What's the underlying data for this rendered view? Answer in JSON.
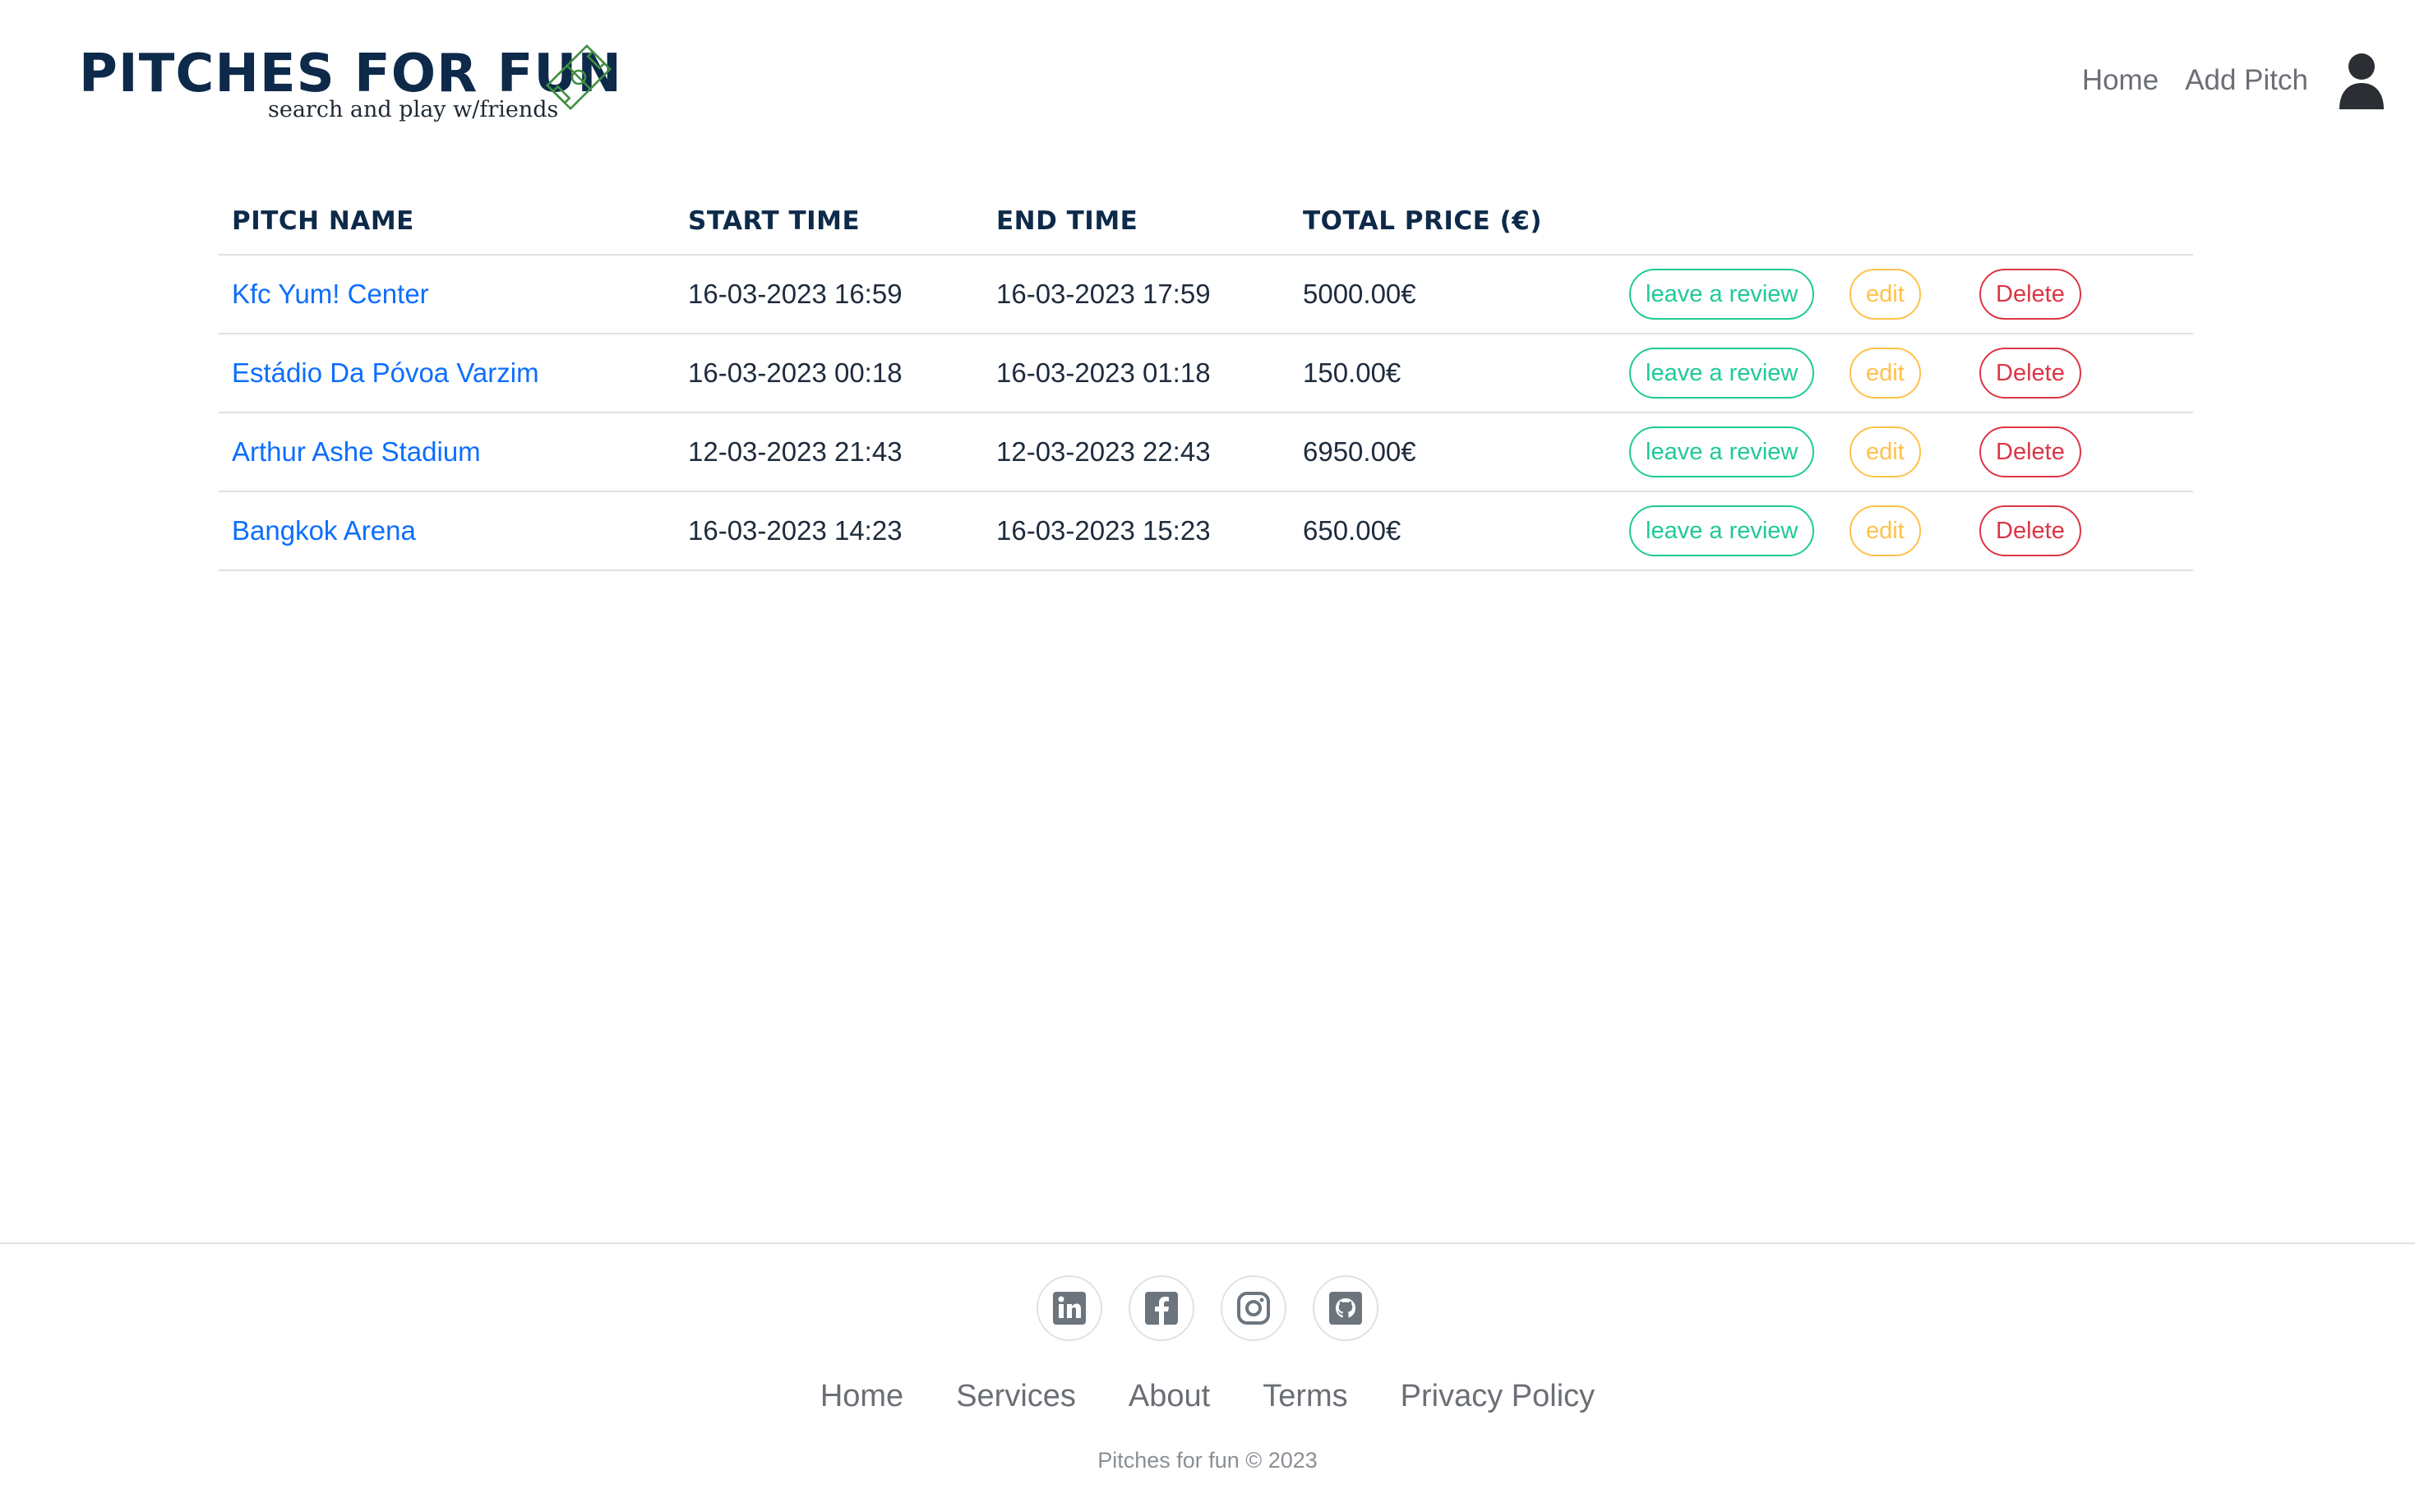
{
  "brand": {
    "title": "Pitches for fun",
    "subtitle": "search and play w/friends",
    "icon": "soccer-pitch-icon",
    "color": "#0d2a4a",
    "icon_color": "#3f8f3f"
  },
  "nav": {
    "home": "Home",
    "add_pitch": "Add Pitch",
    "user_icon": "user-icon"
  },
  "table": {
    "headers": [
      "Pitch name",
      "Start time",
      "End time",
      "Total price (€)"
    ],
    "rows": [
      {
        "pitch_name": "Kfc Yum! Center",
        "start_time": "16-03-2023 16:59",
        "end_time": "16-03-2023 17:59",
        "total_price": "5000.00€"
      },
      {
        "pitch_name": "Estádio Da Póvoa Varzim",
        "start_time": "16-03-2023 00:18",
        "end_time": "16-03-2023 01:18",
        "total_price": "150.00€"
      },
      {
        "pitch_name": "Arthur Ashe Stadium",
        "start_time": "12-03-2023 21:43",
        "end_time": "12-03-2023 22:43",
        "total_price": "6950.00€"
      },
      {
        "pitch_name": "Bangkok Arena",
        "start_time": "16-03-2023 14:23",
        "end_time": "16-03-2023 15:23",
        "total_price": "650.00€"
      }
    ],
    "actions": {
      "review": "leave a review",
      "edit": "edit",
      "delete": "Delete"
    },
    "colors": {
      "link": "#0d6efd",
      "review": "#20c997",
      "edit": "#ffc14a",
      "delete": "#dc3545"
    }
  },
  "footer": {
    "socials": [
      "linkedin-icon",
      "facebook-icon",
      "instagram-icon",
      "github-icon"
    ],
    "links": [
      "Home",
      "Services",
      "About",
      "Terms",
      "Privacy Policy"
    ],
    "copyright": "Pitches for fun © 2023"
  }
}
